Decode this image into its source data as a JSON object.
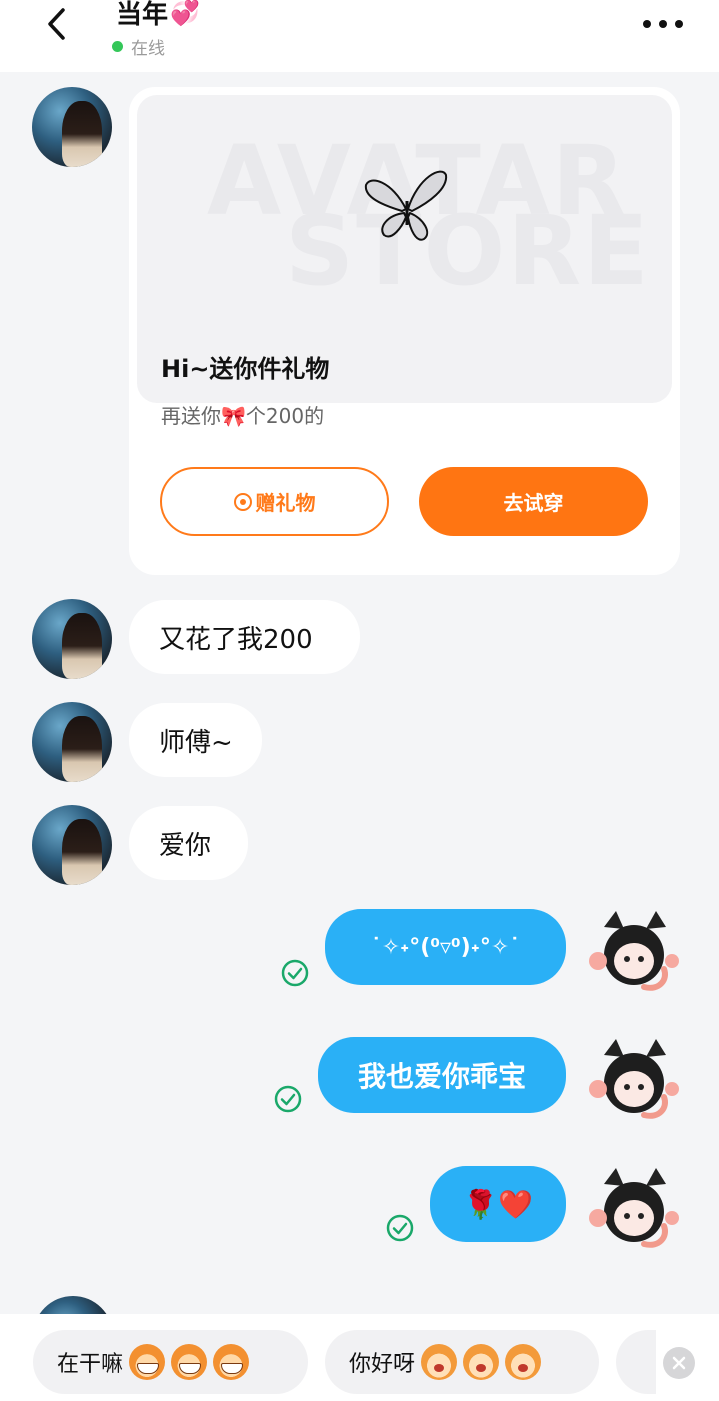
{
  "header": {
    "title": "当年",
    "title_emoji": "💞",
    "status": "在线"
  },
  "gift_card": {
    "banner_word_1": "AVATAR",
    "banner_word_2": "STORE",
    "title": "Hi~送你件礼物",
    "subtitle": "再送你🎀个200的",
    "gift_button": "赠礼物",
    "try_button": "去试穿"
  },
  "messages_in": [
    {
      "text": "又花了我200"
    },
    {
      "text": "师傅~"
    },
    {
      "text": "爱你"
    }
  ],
  "messages_out": [
    {
      "text": "˙✧˖°(⁰▿⁰)˖°✧˙"
    },
    {
      "text": "我也爱你乖宝"
    },
    {
      "text": "🌹❤️"
    }
  ],
  "quick_replies": [
    {
      "text": "在干嘛"
    },
    {
      "text": "你好呀"
    }
  ],
  "colors": {
    "accent_orange": "#ff7512",
    "bubble_blue": "#2ab0f6",
    "online_green": "#34c759",
    "read_check_green": "#1aa86a"
  }
}
